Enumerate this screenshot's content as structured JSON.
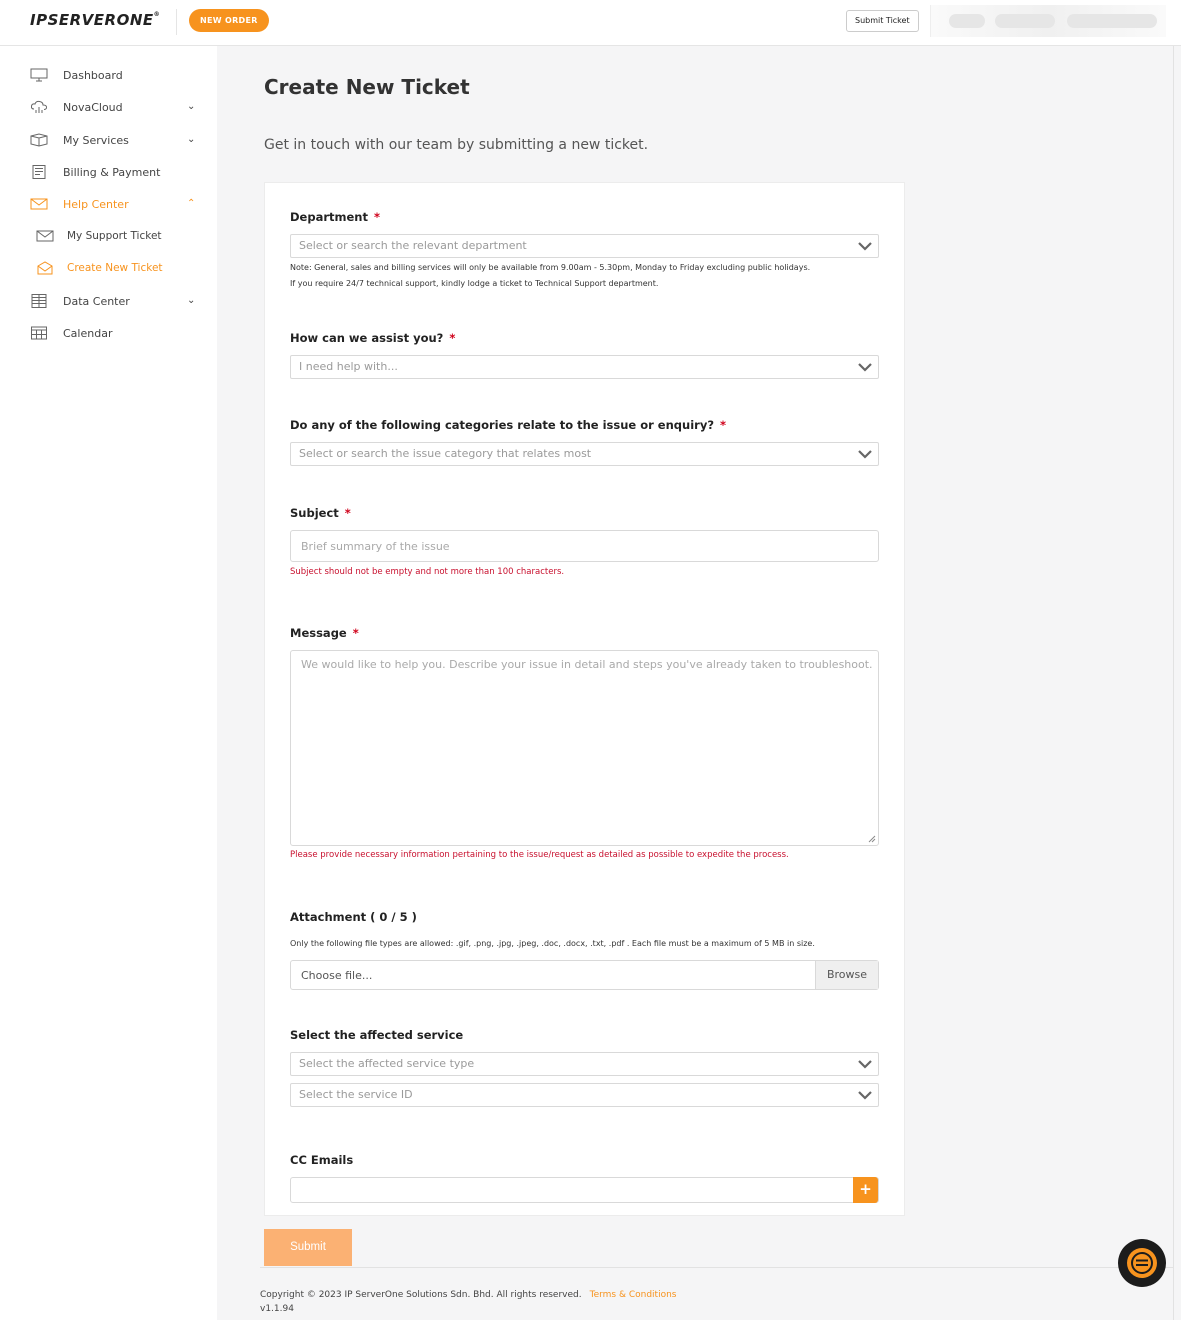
{
  "header": {
    "logo_text": "IPSERVERONE",
    "new_order_label": "NEW ORDER",
    "submit_ticket_label": "Submit Ticket"
  },
  "sidebar": {
    "items": [
      {
        "label": "Dashboard",
        "icon": "monitor-icon"
      },
      {
        "label": "NovaCloud",
        "icon": "cloud-icon",
        "chevron": "down"
      },
      {
        "label": "My Services",
        "icon": "box-icon",
        "chevron": "down"
      },
      {
        "label": "Billing & Payment",
        "icon": "invoice-icon"
      },
      {
        "label": "Help Center",
        "icon": "envelope-icon",
        "chevron": "up",
        "active": true
      },
      {
        "label": "My Support Ticket",
        "icon": "envelope-icon",
        "sub": true
      },
      {
        "label": "Create New Ticket",
        "icon": "envelope-open-icon",
        "sub": true,
        "current": true
      },
      {
        "label": "Data Center",
        "icon": "server-icon",
        "chevron": "down"
      },
      {
        "label": "Calendar",
        "icon": "calendar-icon"
      }
    ]
  },
  "page": {
    "title": "Create New Ticket",
    "subtitle": "Get in touch with our team by submitting a new ticket."
  },
  "form": {
    "department": {
      "label": "Department",
      "required": "*",
      "placeholder": "Select or search the relevant department",
      "note1": "Note: General, sales and billing services will only be available from 9.00am - 5.30pm, Monday to Friday excluding public holidays.",
      "note2": "If you require 24/7 technical support, kindly lodge a ticket to Technical Support department."
    },
    "assist": {
      "label": "How can we assist you?",
      "required": "*",
      "placeholder": "I need help with..."
    },
    "category": {
      "label": "Do any of the following categories relate to the issue or enquiry?",
      "required": "*",
      "placeholder": "Select or search the issue category that relates most"
    },
    "subject": {
      "label": "Subject",
      "required": "*",
      "placeholder": "Brief summary of the issue",
      "error": "Subject should not be empty and not more than 100 characters."
    },
    "message": {
      "label": "Message",
      "required": "*",
      "placeholder": "We would like to help you. Describe your issue in detail and steps you've already taken to troubleshoot.",
      "error": "Please provide necessary information pertaining to the issue/request as detailed as possible to expedite the process."
    },
    "attachment": {
      "label": "Attachment ( 0 / 5 )",
      "note": "Only the following file types are allowed: .gif, .png, .jpg, .jpeg, .doc, .docx, .txt, .pdf . Each file must be a maximum of 5 MB in size.",
      "placeholder": "Choose file...",
      "browse_label": "Browse"
    },
    "service": {
      "label": "Select the affected service",
      "type_placeholder": "Select the affected service type",
      "id_placeholder": "Select the service ID"
    },
    "cc": {
      "label": "CC Emails",
      "add_label": "+"
    },
    "submit_label": "Submit"
  },
  "footer": {
    "copyright": "Copyright © 2023 IP ServerOne Solutions Sdn. Bhd. All rights reserved.",
    "terms_label": "Terms & Conditions",
    "version": "v1.1.94"
  },
  "colors": {
    "accent": "#f7931e",
    "error": "#c8102e",
    "submit_disabled": "#fbb173"
  }
}
